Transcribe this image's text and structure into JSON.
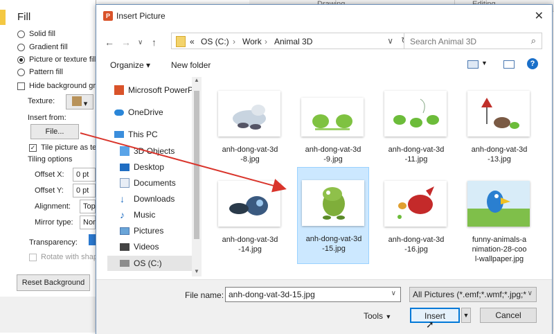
{
  "ribbon": {
    "drawing": "Drawing",
    "editing": "Editing"
  },
  "format_pane": {
    "fill_heading": "Fill",
    "options": [
      {
        "label": "Solid fill",
        "selected": false
      },
      {
        "label": "Gradient fill",
        "selected": false
      },
      {
        "label": "Picture or texture fill",
        "selected": true
      },
      {
        "label": "Pattern fill",
        "selected": false
      }
    ],
    "hide_bg_label": "Hide background graphics",
    "texture_label": "Texture:",
    "insert_from_label": "Insert from:",
    "file_button": "File...",
    "tile_label": "Tile picture as texture",
    "tiling_heading": "Tiling options",
    "offset_x_label": "Offset X:",
    "offset_x_value": "0 pt",
    "offset_y_label": "Offset Y:",
    "offset_y_value": "0 pt",
    "alignment_label": "Alignment:",
    "alignment_value": "Top",
    "mirror_label": "Mirror type:",
    "mirror_value": "None",
    "transparency_label": "Transparency:",
    "rotate_label": "Rotate with shape",
    "reset_button": "Reset Background"
  },
  "dialog": {
    "title": "Insert Picture",
    "breadcrumb": [
      "«",
      "OS (C:)",
      "Work",
      "Animal 3D"
    ],
    "search_placeholder": "Search Animal 3D",
    "organize": "Organize ▾",
    "new_folder": "New folder",
    "nav_items": [
      {
        "label": "Microsoft PowerPoint",
        "icon": "powerpoint-icon"
      },
      {
        "label": "OneDrive",
        "icon": "cloud-icon"
      },
      {
        "label": "This PC",
        "icon": "computer-icon"
      },
      {
        "label": "3D Objects",
        "icon": "cube-icon"
      },
      {
        "label": "Desktop",
        "icon": "desktop-icon"
      },
      {
        "label": "Documents",
        "icon": "documents-icon"
      },
      {
        "label": "Downloads",
        "icon": "downloads-icon"
      },
      {
        "label": "Music",
        "icon": "music-icon"
      },
      {
        "label": "Pictures",
        "icon": "pictures-icon"
      },
      {
        "label": "Videos",
        "icon": "videos-icon"
      },
      {
        "label": "OS (C:)",
        "icon": "drive-icon"
      }
    ],
    "files": [
      {
        "name": "anh-dong-vat-3d-8.jpg",
        "line1": "anh-dong-vat-3d",
        "line2": "-8.jpg"
      },
      {
        "name": "anh-dong-vat-3d-9.jpg",
        "line1": "anh-dong-vat-3d",
        "line2": "-9.jpg"
      },
      {
        "name": "anh-dong-vat-3d-11.jpg",
        "line1": "anh-dong-vat-3d",
        "line2": "-11.jpg"
      },
      {
        "name": "anh-dong-vat-3d-13.jpg",
        "line1": "anh-dong-vat-3d",
        "line2": "-13.jpg"
      },
      {
        "name": "anh-dong-vat-3d-14.jpg",
        "line1": "anh-dong-vat-3d",
        "line2": "-14.jpg"
      },
      {
        "name": "anh-dong-vat-3d-15.jpg",
        "line1": "anh-dong-vat-3d",
        "line2": "-15.jpg",
        "selected": true
      },
      {
        "name": "anh-dong-vat-3d-16.jpg",
        "line1": "anh-dong-vat-3d",
        "line2": "-16.jpg"
      },
      {
        "name": "funny-animals-animation-28-cool-wallpaper.jpg",
        "line1": "funny-animals-a",
        "line2": "nimation-28-coo",
        "line3": "l-wallpaper.jpg"
      }
    ],
    "file_name_label": "File name:",
    "file_name_value": "anh-dong-vat-3d-15.jpg",
    "file_type": "All Pictures (*.emf;*.wmf;*.jpg;*",
    "tools": "Tools",
    "insert": "Insert",
    "cancel": "Cancel"
  },
  "colors": {
    "accent": "#0078d7",
    "selection": "#cce8ff",
    "arrow": "#d9342b"
  }
}
